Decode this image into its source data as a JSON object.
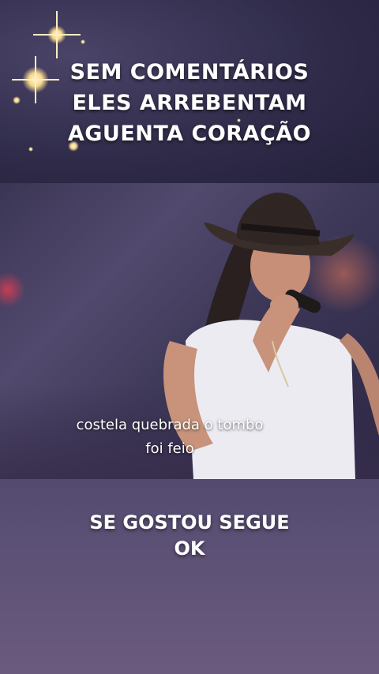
{
  "headline": {
    "line1": "SEM COMENTÁRIOS",
    "line2": "ELES ARREBENTAM",
    "line3": "AGUENTA CORAÇÃO"
  },
  "video": {
    "subtitle_line1": "costela quebrada o tombo",
    "subtitle_line2": "foi feio"
  },
  "footer": {
    "line1": "SE GOSTOU SEGUE",
    "line2": "OK"
  },
  "colors": {
    "text": "#ffffff",
    "background": "#3a3557",
    "sparkle": "#f5d78a"
  }
}
